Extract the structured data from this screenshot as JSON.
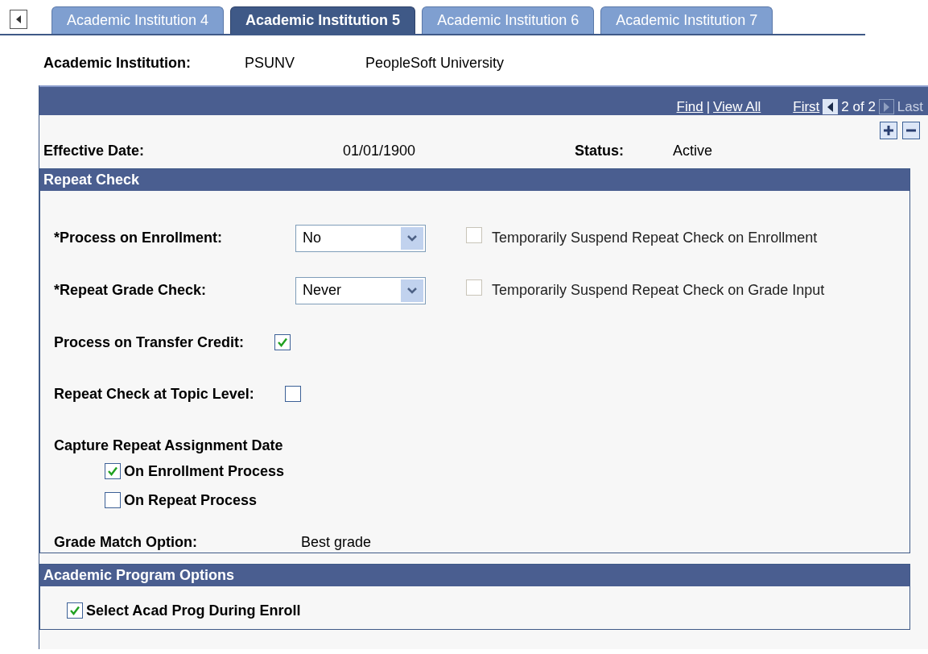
{
  "tabs": [
    {
      "label": "Academic Institution 4",
      "selected": false
    },
    {
      "label": "Academic Institution 5",
      "selected": true
    },
    {
      "label": "Academic Institution 6",
      "selected": false
    },
    {
      "label": "Academic Institution 7",
      "selected": false
    }
  ],
  "institution": {
    "label": "Academic Institution:",
    "code": "PSUNV",
    "name": "PeopleSoft University"
  },
  "nav_bar": {
    "find": "Find",
    "separator": "|",
    "view_all": "View All",
    "first": "First",
    "position": "2 of 2",
    "last": "Last"
  },
  "effective_date": {
    "label": "Effective Date:",
    "value": "01/01/1900"
  },
  "status": {
    "label": "Status:",
    "value": "Active"
  },
  "repeat_check": {
    "title": "Repeat Check",
    "selects": [
      {
        "label": "*Process on Enrollment:",
        "value": "No",
        "checkbox": {
          "label": "Temporarily Suspend Repeat Check on Enrollment",
          "checked": false,
          "disabled": true
        }
      },
      {
        "label": "*Repeat Grade Check:",
        "value": "Never",
        "checkbox": {
          "label": "Temporarily Suspend Repeat Check on Grade Input",
          "checked": false,
          "disabled": true
        }
      }
    ],
    "checks": [
      {
        "label": "Process on Transfer Credit:",
        "checked": true
      },
      {
        "label": "Repeat Check at Topic Level:",
        "checked": false
      }
    ],
    "capture": {
      "label": "Capture Repeat Assignment Date",
      "options": [
        {
          "label": "On Enrollment Process",
          "checked": true
        },
        {
          "label": "On Repeat Process",
          "checked": false
        }
      ]
    },
    "grade_match": {
      "label": "Grade Match Option:",
      "value": "Best grade"
    }
  },
  "program_options": {
    "title": "Academic Program Options",
    "options": [
      {
        "label": "Select Acad Prog During Enroll",
        "checked": true
      }
    ]
  }
}
